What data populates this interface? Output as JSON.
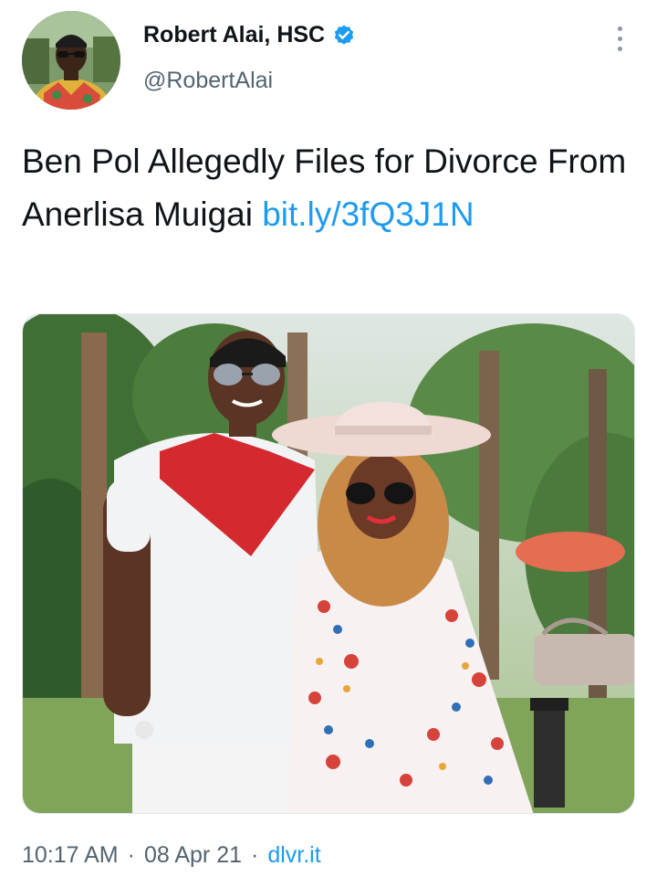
{
  "author": {
    "display_name": "Robert Alai, HSC",
    "handle": "@RobertAlai",
    "verified_icon": "verified-badge-icon",
    "avatar_icon": "avatar-photo"
  },
  "tweet": {
    "text": "Ben Pol Allegedly Files for Divorce From Anerlisa Muigai ",
    "link_text": "bit.ly/​3fQ3J1N"
  },
  "media": {
    "description_icon": "tweet-photo"
  },
  "meta": {
    "time": "10:17 AM",
    "separator": "·",
    "date": "08 Apr 21",
    "source": "dlvr.it"
  },
  "colors": {
    "link": "#1d9bf0",
    "verified": "#1d9bf0",
    "muted": "#536471",
    "text": "#0f1419"
  }
}
